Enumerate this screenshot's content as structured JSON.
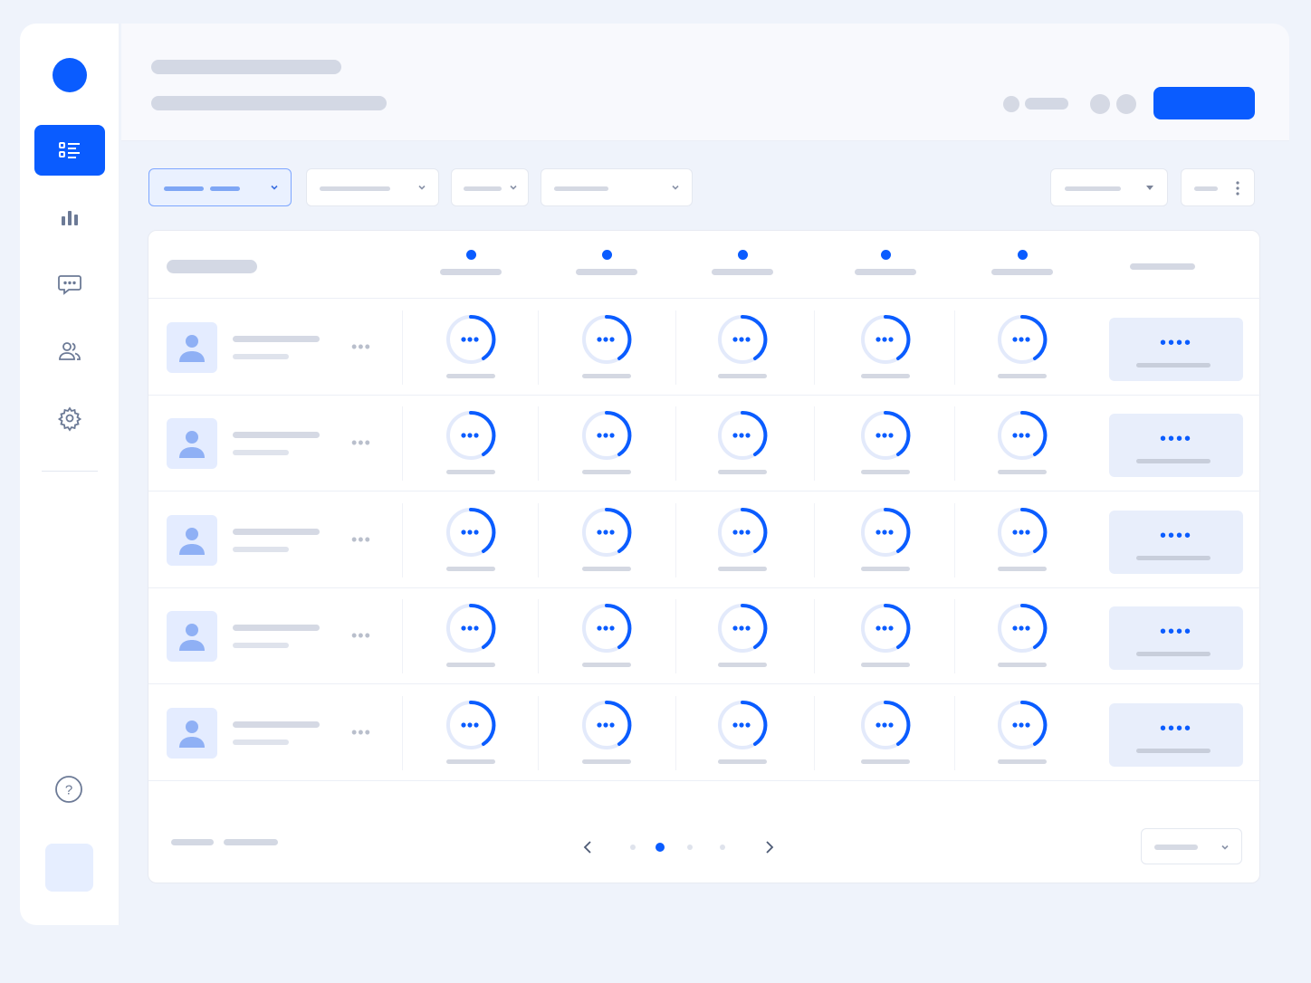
{
  "brand": {
    "accent": "#0a5cff",
    "soft": "#e6eeff"
  },
  "sidebar": {
    "items": [
      {
        "icon": "list-icon",
        "active": true
      },
      {
        "icon": "bar-chart-icon",
        "active": false
      },
      {
        "icon": "chat-icon",
        "active": false
      },
      {
        "icon": "users-icon",
        "active": false
      },
      {
        "icon": "gear-icon",
        "active": false
      }
    ],
    "help_icon": "help-icon",
    "help_symbol": "?"
  },
  "header": {
    "primary_label": ""
  },
  "table": {
    "columns": 5,
    "rows": 5,
    "cell_icon": "ellipsis-icon"
  },
  "pagination": {
    "pages": 4,
    "current": 2
  }
}
